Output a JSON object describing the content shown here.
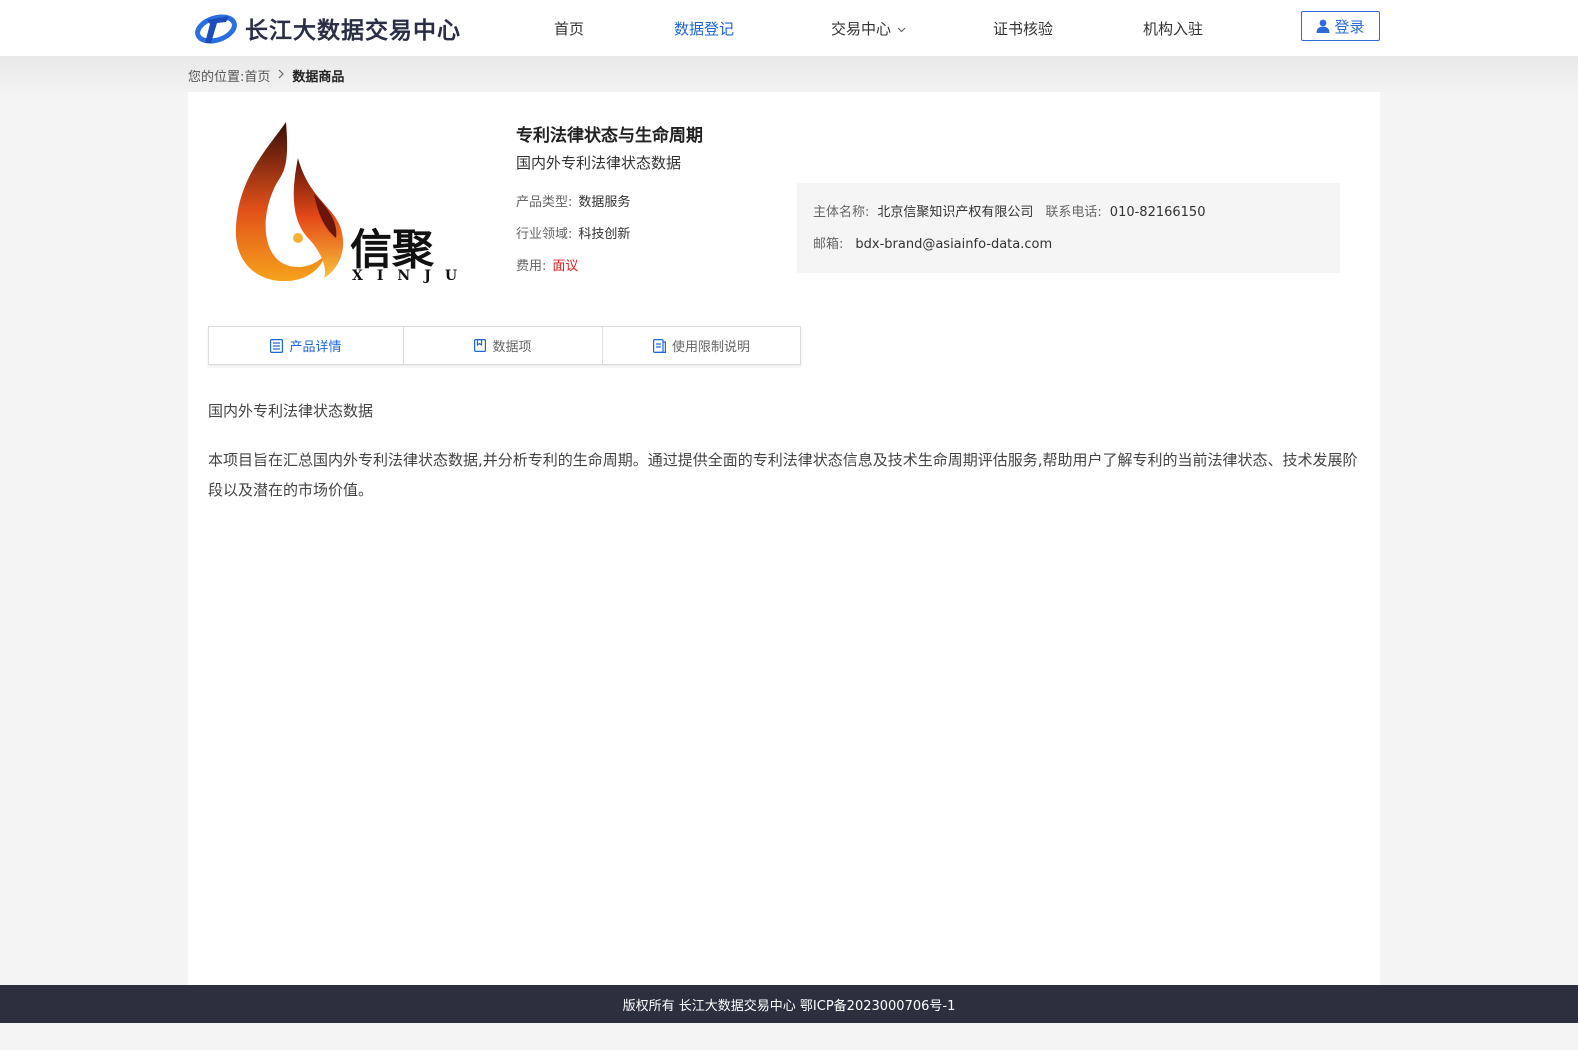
{
  "header": {
    "brand_name": "长江大数据交易中心",
    "nav": [
      {
        "label": "首页"
      },
      {
        "label": "数据登记"
      },
      {
        "label": "交易中心"
      },
      {
        "label": "证书核验"
      },
      {
        "label": "机构入驻"
      }
    ],
    "active_nav": "数据登记",
    "login_label": "登录",
    "accent_color": "#1e66d6"
  },
  "breadcrumb": {
    "prefix": "您的位置:",
    "home": "首页",
    "current": "数据商品"
  },
  "product": {
    "logo_text": "信聚",
    "logo_subtext": "XINJU",
    "title": "专利法律状态与生命周期",
    "subtitle": "国内外专利法律状态数据",
    "type_label": "产品类型:",
    "type_value": "数据服务",
    "industry_label": "行业领域:",
    "industry_value": "科技创新",
    "fee_label": "费用:",
    "fee_value": "面议"
  },
  "contact": {
    "entity_label": "主体名称:",
    "entity_value": "北京信聚知识产权有限公司",
    "phone_label": "联系电话:",
    "phone_value": "010-82166150",
    "email_label": "邮箱:",
    "email_value": "bdx-brand@asiainfo-data.com"
  },
  "tabs": [
    {
      "label": "产品详情",
      "icon": "list-icon",
      "active": true
    },
    {
      "label": "数据项",
      "icon": "bookmark-icon",
      "active": false
    },
    {
      "label": "使用限制说明",
      "icon": "document-icon",
      "active": false
    }
  ],
  "description": {
    "title": "国内外专利法律状态数据",
    "body": "本项目旨在汇总国内外专利法律状态数据,并分析专利的生命周期。通过提供全面的专利法律状态信息及技术生命周期评估服务,帮助用户了解专利的当前法律状态、技术发展阶段以及潜在的市场价值。"
  },
  "footer": {
    "text": "版权所有 长江大数据交易中心 鄂ICP备2023000706号-1"
  }
}
